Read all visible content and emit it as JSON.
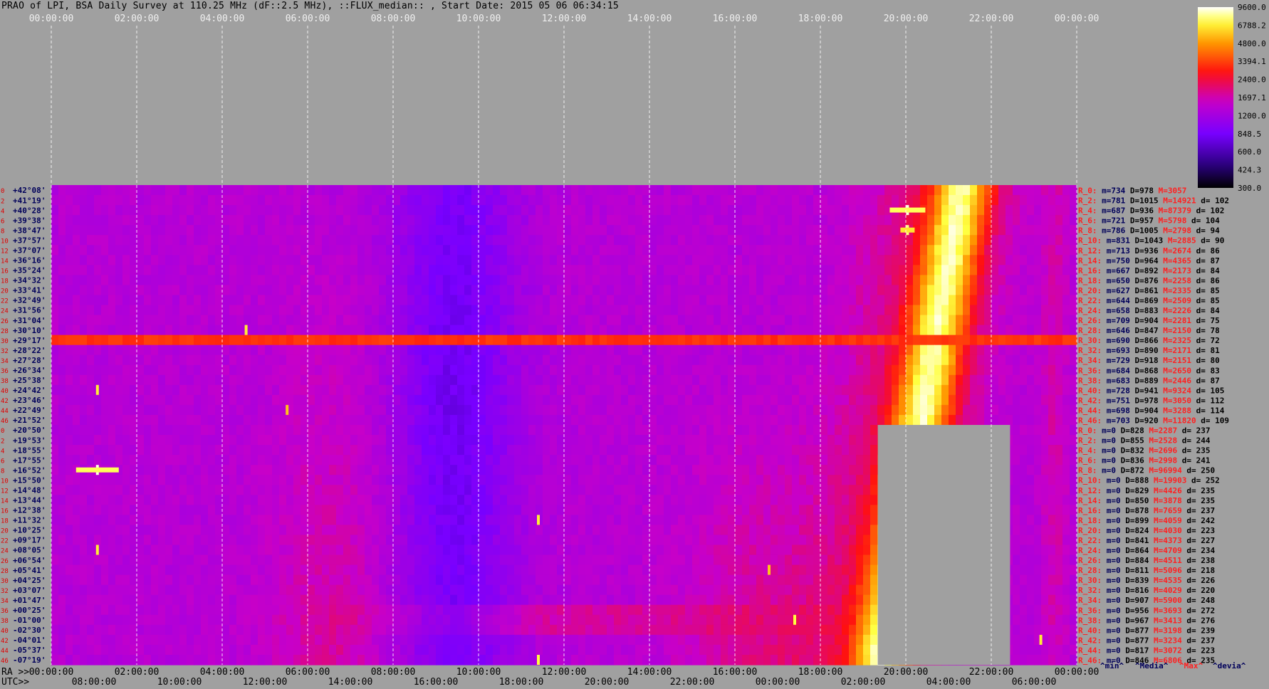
{
  "title": "PRAO of LPI, BSA Daily Survey at 110.25 MHz (dF::2.5 MHz), ::FLUX_median:: , Start Date: 2015 05 06 06:34:15",
  "colors": {
    "background": "#a0a0a0",
    "low": "#000000",
    "purple": "#7a00ff",
    "magenta": "#c800c8",
    "red": "#ff1010",
    "orange": "#ff9000",
    "yellow": "#ffff40",
    "white": "#ffffff",
    "stat_m": "#00005a",
    "stat_M": "#ff2020",
    "row_label": "#00005a",
    "row_index": "#e00000"
  },
  "chart_data": {
    "type": "heatmap",
    "x_top_label": "",
    "x_top_ticks": [
      "00:00:00",
      "02:00:00",
      "04:00:00",
      "06:00:00",
      "08:00:00",
      "10:00:00",
      "12:00:00",
      "14:00:00",
      "16:00:00",
      "18:00:00",
      "20:00:00",
      "22:00:00",
      "00:00:00"
    ],
    "x_bottom_ra_label": "RA >>",
    "x_bottom_ra_ticks": [
      "00:00:00",
      "02:00:00",
      "04:00:00",
      "06:00:00",
      "08:00:00",
      "10:00:00",
      "12:00:00",
      "14:00:00",
      "16:00:00",
      "18:00:00",
      "20:00:00",
      "22:00:00",
      "00:00:00"
    ],
    "x_bottom_utc_label": "UTC>>",
    "x_bottom_utc_ticks": [
      "08:00:00",
      "10:00:00",
      "12:00:00",
      "14:00:00",
      "16:00:00",
      "18:00:00",
      "20:00:00",
      "22:00:00",
      "00:00:00",
      "02:00:00",
      "04:00:00",
      "06:00:00"
    ],
    "row_indices": [
      "0",
      "2",
      "4",
      "6",
      "8",
      "10",
      "12",
      "14",
      "16",
      "18",
      "20",
      "22",
      "24",
      "26",
      "28",
      "30",
      "32",
      "34",
      "36",
      "38",
      "40",
      "42",
      "44",
      "46",
      "0",
      "2",
      "4",
      "6",
      "8",
      "10",
      "12",
      "14",
      "16",
      "18",
      "20",
      "22",
      "24",
      "26",
      "28",
      "30",
      "32",
      "34",
      "36",
      "38",
      "40",
      "42",
      "44",
      "46"
    ],
    "declinations": [
      "+42°08'",
      "+41°19'",
      "+40°28'",
      "+39°38'",
      "+38°47'",
      "+37°57'",
      "+37°07'",
      "+36°16'",
      "+35°24'",
      "+34°32'",
      "+33°41'",
      "+32°49'",
      "+31°56'",
      "+31°04'",
      "+30°10'",
      "+29°17'",
      "+28°22'",
      "+27°28'",
      "+26°34'",
      "+25°38'",
      "+24°42'",
      "+23°46'",
      "+22°49'",
      "+21°52'",
      "+20°50'",
      "+19°53'",
      "+18°55'",
      "+17°55'",
      "+16°52'",
      "+15°50'",
      "+14°48'",
      "+13°44'",
      "+12°38'",
      "+11°32'",
      "+10°25'",
      "+09°17'",
      "+08°05'",
      "+06°54'",
      "+05°41'",
      "+04°25'",
      "+03°07'",
      "+01°47'",
      "+00°25'",
      "-01°00'",
      "-02°30'",
      "-04°01'",
      "-05°37'",
      "-07°19'"
    ],
    "colorbar": {
      "ticks": [
        "9600.0",
        "6788.2",
        "4800.0",
        "3394.1",
        "2400.0",
        "1697.1",
        "1200.0",
        "848.5",
        "600.0",
        "424.3",
        "300.0"
      ],
      "values": [
        9600.0,
        6788.2,
        4800.0,
        3394.1,
        2400.0,
        1697.1,
        1200.0,
        848.5,
        600.0,
        424.3,
        300.0
      ],
      "scale": "log"
    },
    "row_stats": [
      {
        "r": "R_0:",
        "m": "m=734",
        "D": "D=978",
        "M": "M=3057",
        "d": ""
      },
      {
        "r": "R_2:",
        "m": "m=781",
        "D": "D=1015",
        "M": "M=14921",
        "d": "d= 102"
      },
      {
        "r": "R_4:",
        "m": "m=687",
        "D": "D=936",
        "M": "M=87379",
        "d": "d= 102"
      },
      {
        "r": "R_6:",
        "m": "m=721",
        "D": "D=957",
        "M": "M=5798",
        "d": "d= 104"
      },
      {
        "r": "R_8:",
        "m": "m=786",
        "D": "D=1005",
        "M": "M=2798",
        "d": "d= 94"
      },
      {
        "r": "R_10:",
        "m": "m=831",
        "D": "D=1043",
        "M": "M=2885",
        "d": "d= 90"
      },
      {
        "r": "R_12:",
        "m": "m=713",
        "D": "D=936",
        "M": "M=2674",
        "d": "d= 86"
      },
      {
        "r": "R_14:",
        "m": "m=750",
        "D": "D=964",
        "M": "M=4365",
        "d": "d= 87"
      },
      {
        "r": "R_16:",
        "m": "m=667",
        "D": "D=892",
        "M": "M=2173",
        "d": "d= 84"
      },
      {
        "r": "R_18:",
        "m": "m=650",
        "D": "D=876",
        "M": "M=2258",
        "d": "d= 86"
      },
      {
        "r": "R_20:",
        "m": "m=627",
        "D": "D=861",
        "M": "M=2335",
        "d": "d= 85"
      },
      {
        "r": "R_22:",
        "m": "m=644",
        "D": "D=869",
        "M": "M=2509",
        "d": "d= 85"
      },
      {
        "r": "R_24:",
        "m": "m=658",
        "D": "D=883",
        "M": "M=2226",
        "d": "d= 84"
      },
      {
        "r": "R_26:",
        "m": "m=709",
        "D": "D=904",
        "M": "M=2281",
        "d": "d= 75"
      },
      {
        "r": "R_28:",
        "m": "m=646",
        "D": "D=847",
        "M": "M=2150",
        "d": "d= 78"
      },
      {
        "r": "R_30:",
        "m": "m=690",
        "D": "D=866",
        "M": "M=2325",
        "d": "d= 72"
      },
      {
        "r": "R_32:",
        "m": "m=693",
        "D": "D=890",
        "M": "M=2171",
        "d": "d= 81"
      },
      {
        "r": "R_34:",
        "m": "m=729",
        "D": "D=918",
        "M": "M=2151",
        "d": "d= 80"
      },
      {
        "r": "R_36:",
        "m": "m=684",
        "D": "D=868",
        "M": "M=2650",
        "d": "d= 83"
      },
      {
        "r": "R_38:",
        "m": "m=683",
        "D": "D=889",
        "M": "M=2446",
        "d": "d= 87"
      },
      {
        "r": "R_40:",
        "m": "m=728",
        "D": "D=941",
        "M": "M=9324",
        "d": "d= 105"
      },
      {
        "r": "R_42:",
        "m": "m=751",
        "D": "D=978",
        "M": "M=3050",
        "d": "d= 112"
      },
      {
        "r": "R_44:",
        "m": "m=698",
        "D": "D=904",
        "M": "M=3288",
        "d": "d= 114"
      },
      {
        "r": "R_46:",
        "m": "m=703",
        "D": "D=920",
        "M": "M=11820",
        "d": "d= 109"
      },
      {
        "r": "R_0:",
        "m": "m=0",
        "D": "D=828",
        "M": "M=2287",
        "d": "d= 237"
      },
      {
        "r": "R_2:",
        "m": "m=0",
        "D": "D=855",
        "M": "M=2528",
        "d": "d= 244"
      },
      {
        "r": "R_4:",
        "m": "m=0",
        "D": "D=832",
        "M": "M=2696",
        "d": "d= 235"
      },
      {
        "r": "R_6:",
        "m": "m=0",
        "D": "D=836",
        "M": "M=2998",
        "d": "d= 241"
      },
      {
        "r": "R_8:",
        "m": "m=0",
        "D": "D=872",
        "M": "M=96994",
        "d": "d= 250"
      },
      {
        "r": "R_10:",
        "m": "m=0",
        "D": "D=888",
        "M": "M=19903",
        "d": "d= 252"
      },
      {
        "r": "R_12:",
        "m": "m=0",
        "D": "D=829",
        "M": "M=4426",
        "d": "d= 235"
      },
      {
        "r": "R_14:",
        "m": "m=0",
        "D": "D=850",
        "M": "M=3878",
        "d": "d= 235"
      },
      {
        "r": "R_16:",
        "m": "m=0",
        "D": "D=878",
        "M": "M=7659",
        "d": "d= 237"
      },
      {
        "r": "R_18:",
        "m": "m=0",
        "D": "D=899",
        "M": "M=4059",
        "d": "d= 242"
      },
      {
        "r": "R_20:",
        "m": "m=0",
        "D": "D=824",
        "M": "M=4030",
        "d": "d= 223"
      },
      {
        "r": "R_22:",
        "m": "m=0",
        "D": "D=841",
        "M": "M=4373",
        "d": "d= 227"
      },
      {
        "r": "R_24:",
        "m": "m=0",
        "D": "D=864",
        "M": "M=4709",
        "d": "d= 234"
      },
      {
        "r": "R_26:",
        "m": "m=0",
        "D": "D=884",
        "M": "M=4511",
        "d": "d= 238"
      },
      {
        "r": "R_28:",
        "m": "m=0",
        "D": "D=811",
        "M": "M=5096",
        "d": "d= 218"
      },
      {
        "r": "R_30:",
        "m": "m=0",
        "D": "D=839",
        "M": "M=4535",
        "d": "d= 226"
      },
      {
        "r": "R_32:",
        "m": "m=0",
        "D": "D=816",
        "M": "M=4029",
        "d": "d= 220"
      },
      {
        "r": "R_34:",
        "m": "m=0",
        "D": "D=907",
        "M": "M=5900",
        "d": "d= 248"
      },
      {
        "r": "R_36:",
        "m": "m=0",
        "D": "D=956",
        "M": "M=3693",
        "d": "d= 272"
      },
      {
        "r": "R_38:",
        "m": "m=0",
        "D": "D=967",
        "M": "M=3413",
        "d": "d= 276"
      },
      {
        "r": "R_40:",
        "m": "m=0",
        "D": "D=877",
        "M": "M=3198",
        "d": "d= 239"
      },
      {
        "r": "R_42:",
        "m": "m=0",
        "D": "D=877",
        "M": "M=3234",
        "d": "d= 237"
      },
      {
        "r": "R_44:",
        "m": "m=0",
        "D": "D=817",
        "M": "M=3072",
        "d": "d= 223"
      },
      {
        "r": "R_46:",
        "m": "m=0",
        "D": "D=846",
        "M": "M=6806",
        "d": "d= 235"
      }
    ],
    "legend": {
      "min": "^min^",
      "median": "^Media^",
      "max": "^Max^",
      "dev": "^devia^"
    }
  }
}
